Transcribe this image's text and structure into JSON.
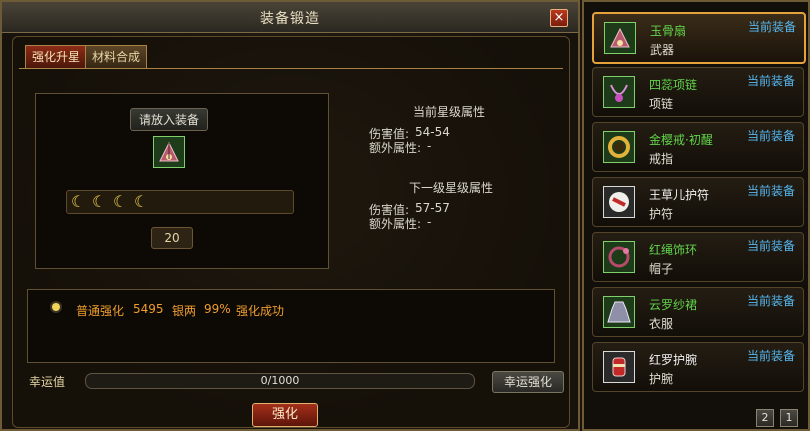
{
  "window": {
    "title": "装备锻造",
    "close_symbol": "×"
  },
  "tabs": [
    {
      "label": "强化升星",
      "active": true
    },
    {
      "label": "材料合成",
      "active": false
    }
  ],
  "forge": {
    "insert_label": "请放入装备",
    "star_count": 4,
    "star_symbol": "☾",
    "level": "20",
    "current": {
      "heading": "当前星级属性",
      "damage_label": "伤害值:",
      "damage_value": "54-54",
      "extra_label": "额外属性:",
      "extra_value": "-"
    },
    "next": {
      "heading": "下一级星级属性",
      "damage_label": "伤害值:",
      "damage_value": "57-57",
      "extra_label": "额外属性:",
      "extra_value": "-"
    }
  },
  "option": {
    "name": "普通强化",
    "cost": "5495",
    "currency": "银两",
    "rate": "99%",
    "result": "强化成功"
  },
  "luck": {
    "label": "幸运值",
    "value_text": "0/1000",
    "fraction": 0.0
  },
  "buttons": {
    "lucky_forge": "幸运强化",
    "forge": "强化"
  },
  "equipment": [
    {
      "name": "玉骨扇",
      "type": "武器",
      "status": "当前装备",
      "name_color": "#62d44a",
      "quality": "green",
      "selected": true
    },
    {
      "name": "四蕊项链",
      "type": "项链",
      "status": "当前装备",
      "name_color": "#62d44a",
      "quality": "green",
      "selected": false
    },
    {
      "name": "金樱戒·初醒",
      "type": "戒指",
      "status": "当前装备",
      "name_color": "#62d44a",
      "quality": "green",
      "selected": false
    },
    {
      "name": "王草儿护符",
      "type": "护符",
      "status": "当前装备",
      "name_color": "#f2f2f2",
      "quality": "white",
      "selected": false
    },
    {
      "name": "红绳饰环",
      "type": "帽子",
      "status": "当前装备",
      "name_color": "#62d44a",
      "quality": "green",
      "selected": false
    },
    {
      "name": "云罗纱裙",
      "type": "衣服",
      "status": "当前装备",
      "name_color": "#62d44a",
      "quality": "green",
      "selected": false
    },
    {
      "name": "红罗护腕",
      "type": "护腕",
      "status": "当前装备",
      "name_color": "#f2f2f2",
      "quality": "white",
      "selected": false
    }
  ],
  "pagination": {
    "pages": [
      "2",
      "1"
    ]
  },
  "icons": {
    "close": "close-icon",
    "slot_item": "fan-weapon-icon",
    "equipment": [
      "fan-weapon-icon",
      "necklace-icon",
      "ring-icon",
      "amulet-icon",
      "hair-ring-icon",
      "dress-icon",
      "bracer-icon"
    ]
  }
}
